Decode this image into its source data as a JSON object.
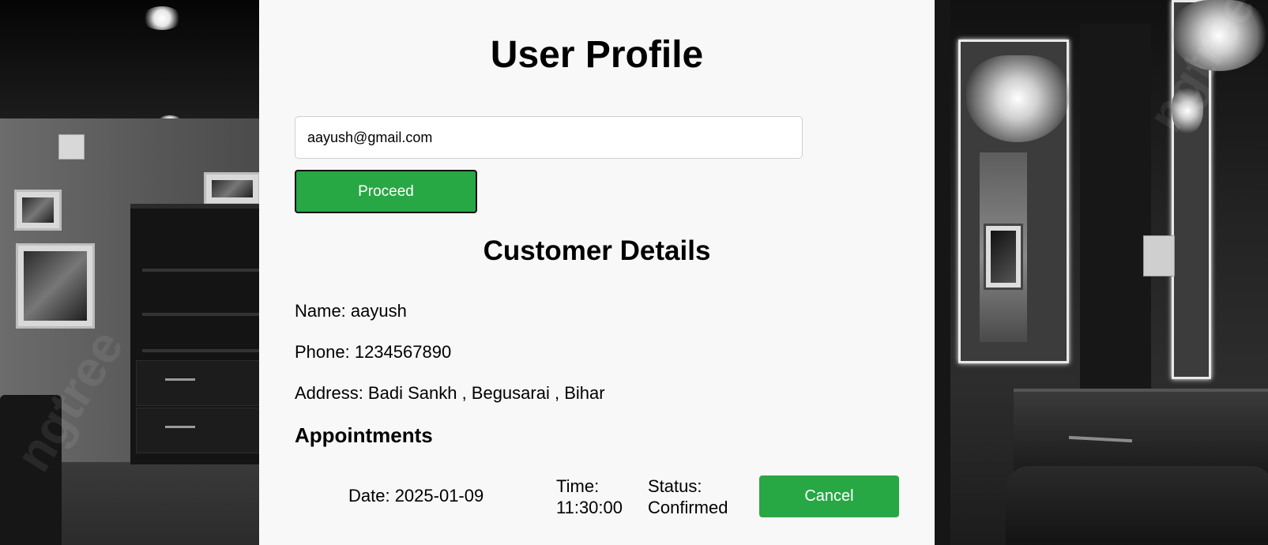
{
  "page": {
    "title": "User Profile"
  },
  "search": {
    "email_value": "aayush@gmail.com",
    "proceed_label": "Proceed"
  },
  "customer": {
    "heading": "Customer Details",
    "name": "Name: aayush",
    "phone": "Phone: 1234567890",
    "address": "Address: Badi Sankh , Begusarai , Bihar"
  },
  "appointments": {
    "heading": "Appointments",
    "items": [
      {
        "date": "Date: 2025-01-09",
        "time_label": "Time:",
        "time_value": "11:30:00",
        "status_label": "Status:",
        "status_value": "Confirmed",
        "cancel_label": "Cancel"
      }
    ]
  },
  "colors": {
    "accent": "#28a745",
    "card_background": "#f8f8f8"
  }
}
